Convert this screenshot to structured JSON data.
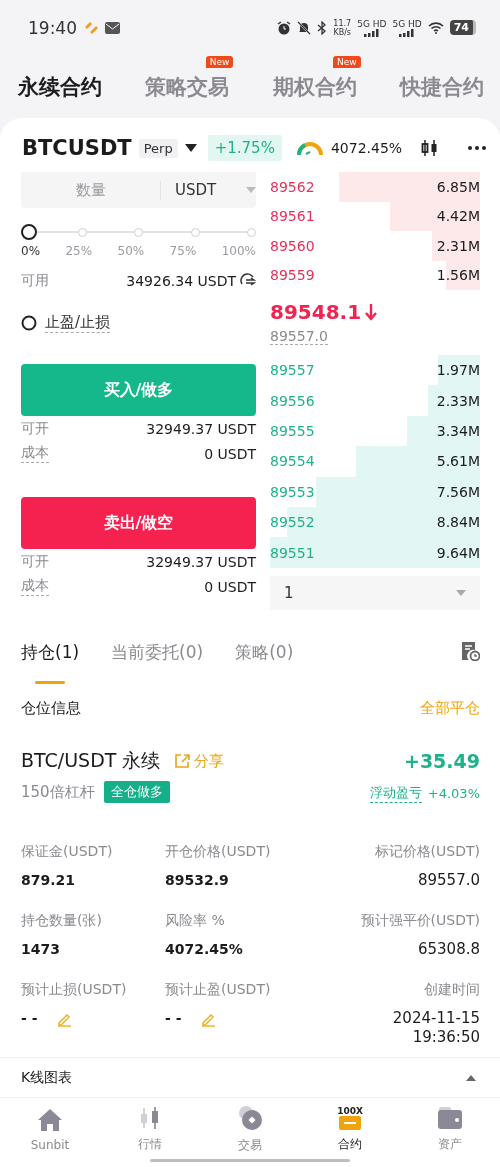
{
  "status_bar": {
    "time": "19:40",
    "net_speed": "11.7",
    "net_unit": "KB/s",
    "networks": [
      "5G HD",
      "5G HD"
    ],
    "battery": "74"
  },
  "top_tabs": [
    {
      "label": "永续合约",
      "selected": true
    },
    {
      "label": "策略交易",
      "selected": false,
      "badge": "New"
    },
    {
      "label": "期权合约",
      "selected": false,
      "badge": "New"
    },
    {
      "label": "快捷合约",
      "selected": false
    }
  ],
  "instrument": {
    "symbol": "BTCUSDT",
    "type_tag": "Perp",
    "change": "+1.75%",
    "risk": "4072.45%"
  },
  "order_form": {
    "amount_label": "数量",
    "unit": "USDT",
    "slider": {
      "level": 0,
      "marks": [
        "0%",
        "25%",
        "50%",
        "75%",
        "100%"
      ]
    },
    "available_label": "可用",
    "available": "34926.34 USDT",
    "tpsl": {
      "label": "止盈/止损",
      "checked": false
    },
    "actions": [
      {
        "kind": "buy",
        "label": "买入/做多",
        "rows": [
          {
            "label": "可开",
            "value": "32949.37 USDT",
            "dashed": false
          },
          {
            "label": "成本",
            "value": "0 USDT",
            "dashed": true
          }
        ]
      },
      {
        "kind": "sell",
        "label": "卖出/做空",
        "rows": [
          {
            "label": "可开",
            "value": "32949.37 USDT",
            "dashed": false
          },
          {
            "label": "成本",
            "value": "0 USDT",
            "dashed": true
          }
        ]
      }
    ]
  },
  "order_book": {
    "asks": [
      {
        "price": "89562",
        "size": "6.85M",
        "level": 0.67
      },
      {
        "price": "89561",
        "size": "4.42M",
        "level": 0.43
      },
      {
        "price": "89560",
        "size": "2.31M",
        "level": 0.23
      },
      {
        "price": "89559",
        "size": "1.56M",
        "level": 0.16
      }
    ],
    "last_price": "89548.1",
    "mark_price": "89557.0",
    "bids": [
      {
        "price": "89557",
        "size": "1.97M",
        "level": 0.2
      },
      {
        "price": "89556",
        "size": "2.33M",
        "level": 0.25
      },
      {
        "price": "89555",
        "size": "3.34M",
        "level": 0.35
      },
      {
        "price": "89554",
        "size": "5.61M",
        "level": 0.59
      },
      {
        "price": "89553",
        "size": "7.56M",
        "level": 0.78
      },
      {
        "price": "89552",
        "size": "8.84M",
        "level": 0.92
      },
      {
        "price": "89551",
        "size": "9.64M",
        "level": 1.0
      }
    ],
    "precision": "1"
  },
  "position_tabs": [
    {
      "label": "持仓(1)",
      "selected": true
    },
    {
      "label": "当前委托(0)",
      "selected": false
    },
    {
      "label": "策略(0)",
      "selected": false
    }
  ],
  "position_section": {
    "title": "仓位信息",
    "action": "全部平仓"
  },
  "position": {
    "pair": "BTC/USDT 永续",
    "share": "分享",
    "pnl": "+35.49",
    "leverage": "150倍杠杆",
    "mode_tag": "全仓做多",
    "pnl_label": "浮动盈亏",
    "pnl_pct": "+4.03%",
    "fields": [
      {
        "label": "保证金(USDT)",
        "value": "879.21",
        "editable": false
      },
      {
        "label": "开仓价格(USDT)",
        "value": "89532.9",
        "editable": false
      },
      {
        "label": "标记价格(USDT)",
        "value": "89557.0",
        "editable": false
      },
      {
        "label": "持仓数量(张)",
        "value": "1473",
        "editable": false
      },
      {
        "label": "风险率 %",
        "value": "4072.45%",
        "editable": false
      },
      {
        "label": "预计强平价(USDT)",
        "value": "65308.8",
        "editable": false
      },
      {
        "label": "预计止损(USDT)",
        "value": "- -",
        "editable": true
      },
      {
        "label": "预计止盈(USDT)",
        "value": "- -",
        "editable": true
      },
      {
        "label": "创建时间",
        "value": "2024-11-15\n19:36:50",
        "editable": false
      }
    ]
  },
  "kline": {
    "label": "K线图表"
  },
  "bottom_nav": [
    {
      "label": "Sunbit",
      "kind": "home",
      "selected": false
    },
    {
      "label": "行情",
      "kind": "market",
      "selected": false
    },
    {
      "label": "交易",
      "kind": "trade",
      "selected": false
    },
    {
      "label": "合约",
      "kind": "futures",
      "badge": "100X",
      "selected": true
    },
    {
      "label": "资产",
      "kind": "assets",
      "selected": false
    }
  ]
}
